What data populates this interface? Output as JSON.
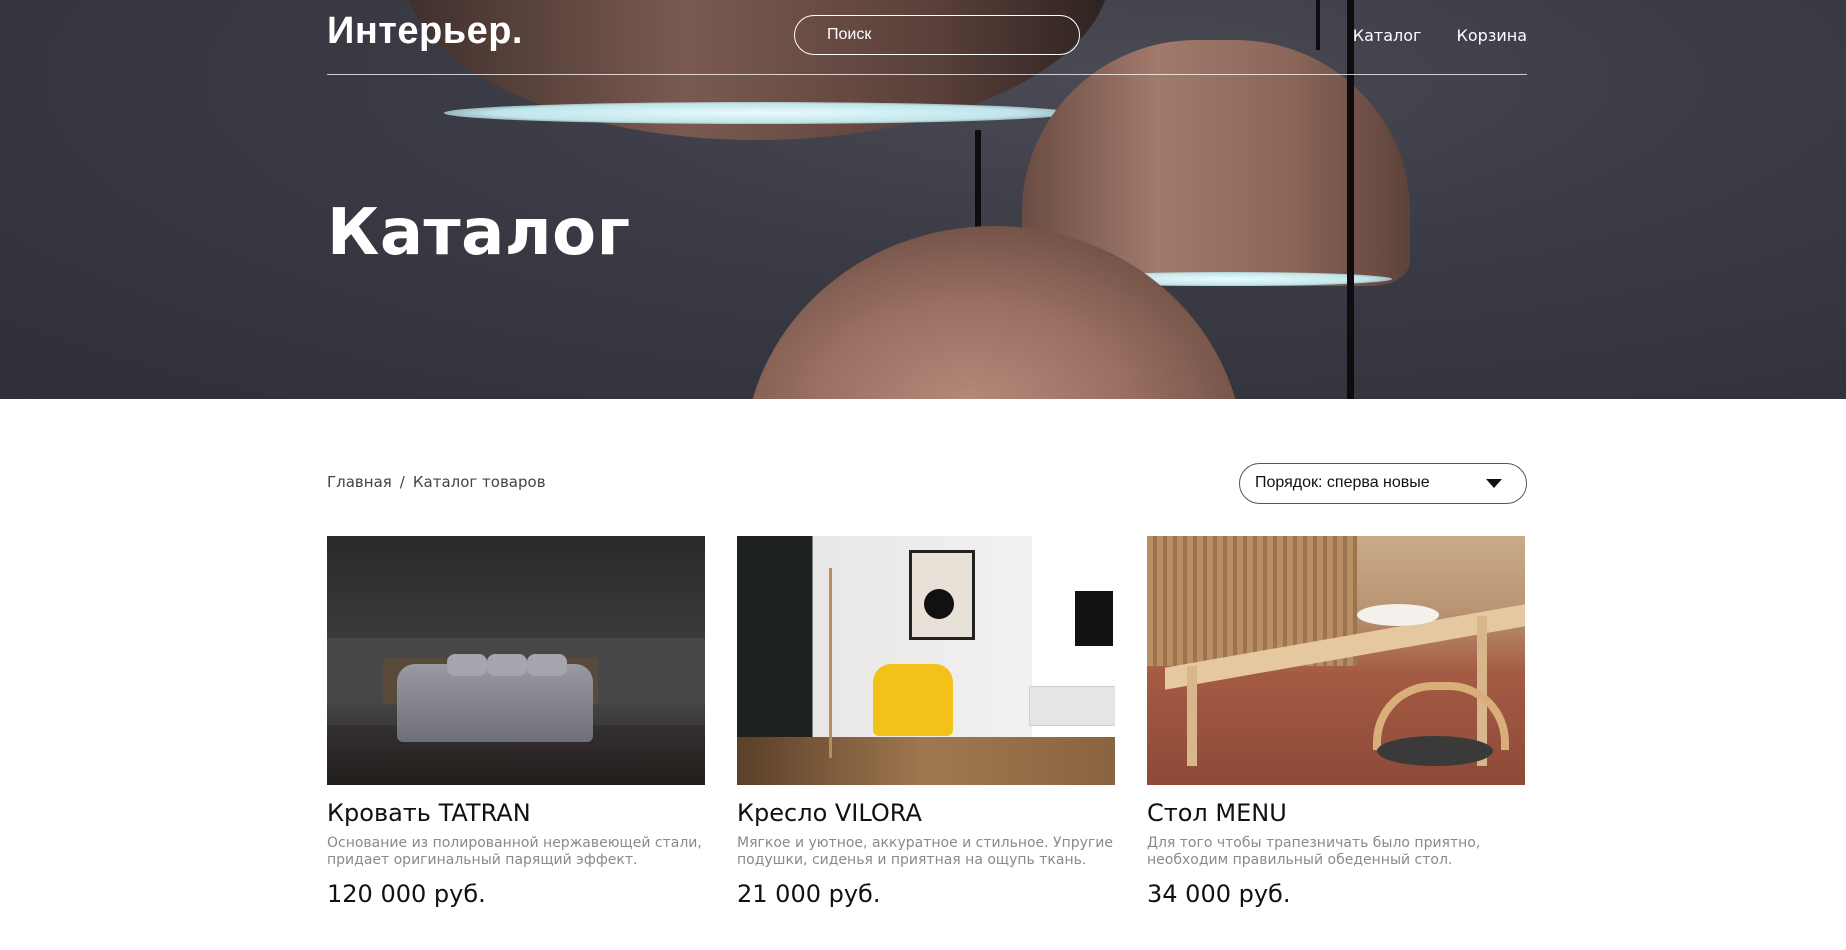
{
  "header": {
    "logo": "Интерьер.",
    "search_placeholder": "Поиск",
    "nav": [
      {
        "label": "Каталог"
      },
      {
        "label": "Корзина"
      }
    ]
  },
  "hero": {
    "title": "Каталог"
  },
  "breadcrumb": {
    "home": "Главная",
    "separator": "/",
    "current": "Каталог товаров"
  },
  "sort": {
    "value": "Порядок: сперва новые"
  },
  "products": [
    {
      "name": "Кровать TATRAN",
      "description": "Основание из полированной нержавеющей стали, придает оригинальный парящий эффект.",
      "price": "120 000 руб."
    },
    {
      "name": "Кресло VILORA",
      "description": "Мягкое и уютное, аккуратное и стильное. Упругие подушки, сиденья и приятная на ощупь ткань.",
      "price": "21 000 руб."
    },
    {
      "name": "Стол MENU",
      "description": "Для того чтобы трапезничать было приятно, необходим правильный обеденный стол.",
      "price": "34 000 руб."
    }
  ],
  "colors": {
    "hero_background": "#3a3a44",
    "text": "#111111",
    "muted_text": "#8a8a8a"
  }
}
